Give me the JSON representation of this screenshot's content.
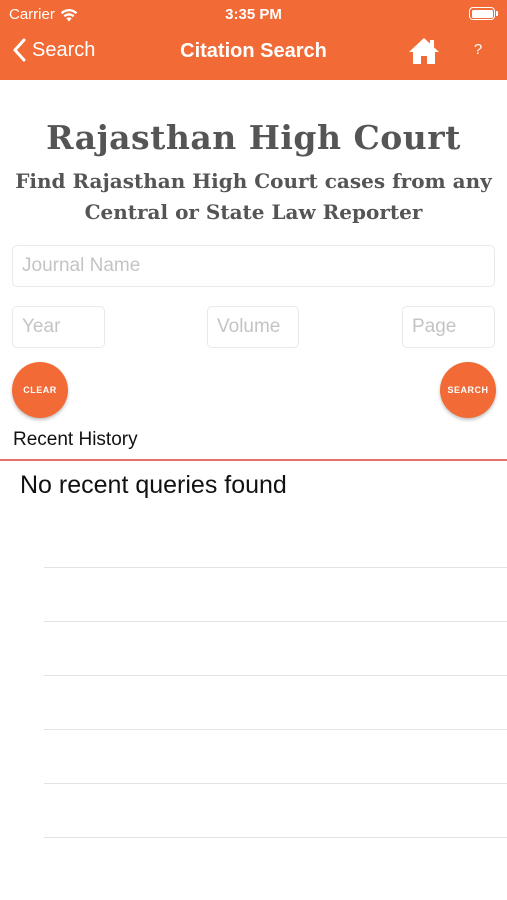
{
  "status_bar": {
    "carrier": "Carrier",
    "time": "3:35 PM"
  },
  "nav": {
    "back_label": "Search",
    "title": "Citation Search",
    "home_icon": "home-icon",
    "help_label": "?"
  },
  "banner": {
    "title": "Rajasthan High Court",
    "subtitle": "Find Rajasthan High Court cases from any Central or State Law Reporter"
  },
  "form": {
    "journal_placeholder": "Journal Name",
    "year_placeholder": "Year",
    "volume_placeholder": "Volume",
    "page_placeholder": "Page",
    "clear_label": "CLEAR",
    "search_label": "SEARCH"
  },
  "history": {
    "heading": "Recent History",
    "empty_message": "No recent queries found"
  },
  "colors": {
    "accent": "#f26a35",
    "divider": "#e8716f"
  }
}
